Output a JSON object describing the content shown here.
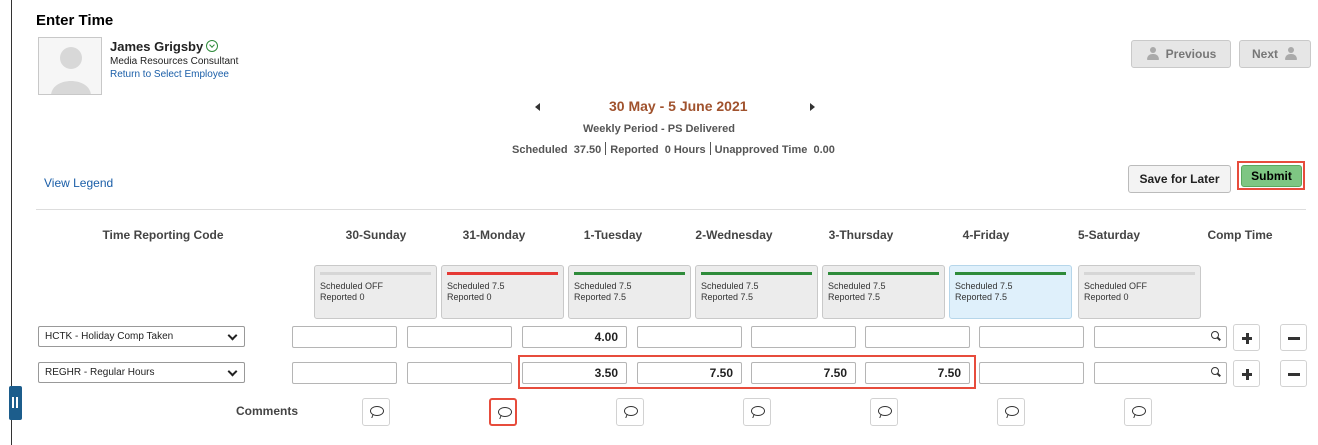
{
  "page": {
    "title": "Enter Time"
  },
  "employee": {
    "name": "James Grigsby",
    "job_title": "Media Resources Consultant",
    "return_link": "Return to Select Employee"
  },
  "nav": {
    "previous_label": "Previous",
    "next_label": "Next"
  },
  "period": {
    "range": "30 May - 5 June 2021",
    "type": "Weekly Period - PS Delivered",
    "scheduled_label": "Scheduled",
    "scheduled_value": "37.50",
    "reported_label": "Reported",
    "reported_value": "0 Hours",
    "unapproved_label": "Unapproved Time",
    "unapproved_value": "0.00"
  },
  "actions": {
    "view_legend": "View Legend",
    "save_for_later": "Save for Later",
    "submit": "Submit"
  },
  "grid": {
    "trc_header": "Time Reporting Code",
    "comp_header": "Comp Time",
    "days": [
      {
        "label": "30-Sunday",
        "scheduled": "Scheduled OFF",
        "reported": "Reported  0",
        "bar_color": "#d6d6d6"
      },
      {
        "label": "31-Monday",
        "scheduled": "Scheduled 7.5",
        "reported": "Reported  0",
        "bar_color": "#e53935"
      },
      {
        "label": "1-Tuesday",
        "scheduled": "Scheduled 7.5",
        "reported": "Reported  7.5",
        "bar_color": "#2e8b3a"
      },
      {
        "label": "2-Wednesday",
        "scheduled": "Scheduled 7.5",
        "reported": "Reported  7.5",
        "bar_color": "#2e8b3a"
      },
      {
        "label": "3-Thursday",
        "scheduled": "Scheduled 7.5",
        "reported": "Reported  7.5",
        "bar_color": "#2e8b3a"
      },
      {
        "label": "4-Friday",
        "scheduled": "Scheduled 7.5",
        "reported": "Reported  7.5",
        "bar_color": "#2e8b3a"
      },
      {
        "label": "5-Saturday",
        "scheduled": "Scheduled OFF",
        "reported": "Reported  0",
        "bar_color": "#d6d6d6"
      }
    ],
    "rows": [
      {
        "trc": "HCTK - Holiday Comp Taken",
        "values": [
          "",
          "",
          "4.00",
          "",
          "",
          "",
          ""
        ],
        "comp": ""
      },
      {
        "trc": "REGHR - Regular Hours",
        "values": [
          "",
          "",
          "3.50",
          "7.50",
          "7.50",
          "7.50",
          ""
        ],
        "comp": ""
      }
    ],
    "comments_label": "Comments"
  },
  "colors": {
    "accent_red": "#e74c3c",
    "submit_green": "#7ec683",
    "link_blue": "#1a5ea8",
    "period_brown": "#a0522d"
  }
}
